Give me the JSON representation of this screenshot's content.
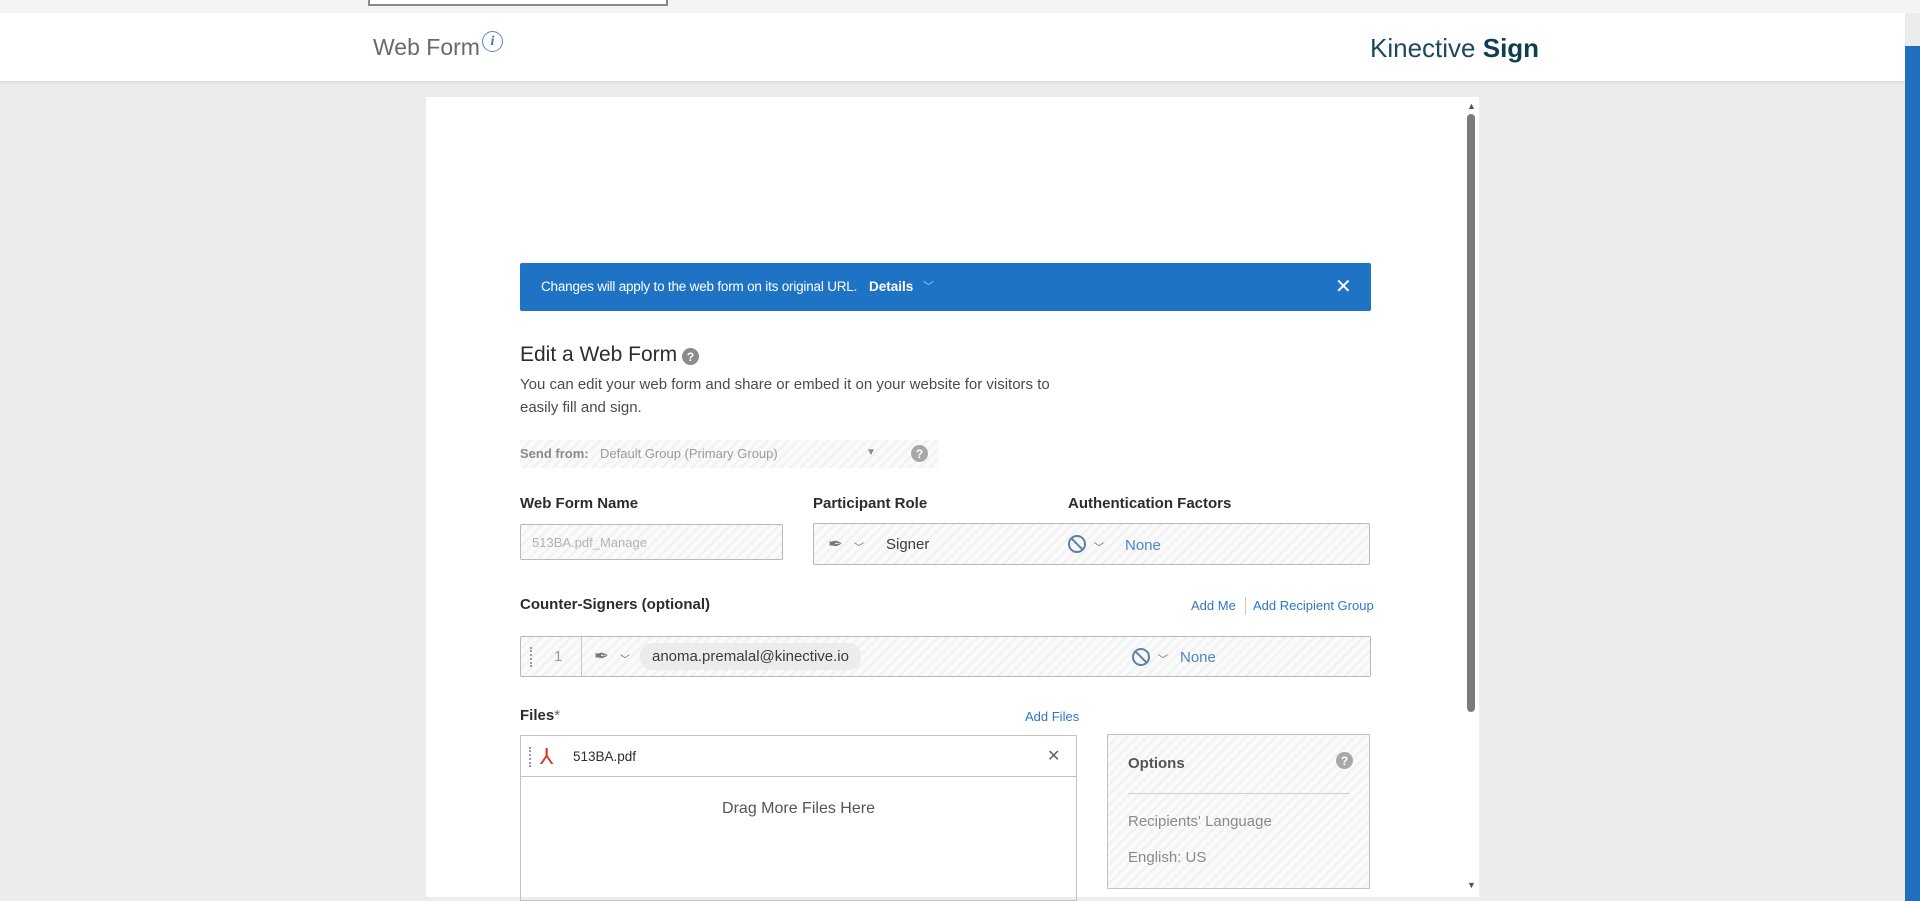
{
  "header": {
    "title": "Web Form",
    "brand_light": "Kinective",
    "brand_bold": "Sign"
  },
  "banner": {
    "message": "Changes will apply to the web form on its original URL.",
    "details_label": "Details"
  },
  "form": {
    "title": "Edit a Web Form",
    "description": "You can edit your web form and share or embed it on your website for visitors to easily fill and sign.",
    "send_from_label": "Send from:",
    "send_from_value": "Default Group (Primary Group)",
    "web_form_name_label": "Web Form Name",
    "web_form_name_value": "513BA.pdf_Manage",
    "participant_role_label": "Participant Role",
    "participant_role_value": "Signer",
    "auth_factors_label": "Authentication Factors",
    "auth_factors_value": "None",
    "counter_signers_label": "Counter-Signers (optional)",
    "add_me_label": "Add Me",
    "add_recipient_group_label": "Add Recipient Group",
    "counter_signer": {
      "index": "1",
      "email": "anoma.premalal@kinective.io",
      "auth_value": "None"
    },
    "files_label": "Files",
    "files_required_mark": "*",
    "add_files_label": "Add Files",
    "file_name": "513BA.pdf",
    "drag_text": "Drag More Files Here"
  },
  "options": {
    "title": "Options",
    "language_label": "Recipients' Language",
    "language_value": "English: US"
  },
  "colors": {
    "accent_blue": "#1f73c5",
    "link_blue": "#2f77c4",
    "brand_text": "#0f3d52",
    "pdf_red": "#d23a2a"
  }
}
